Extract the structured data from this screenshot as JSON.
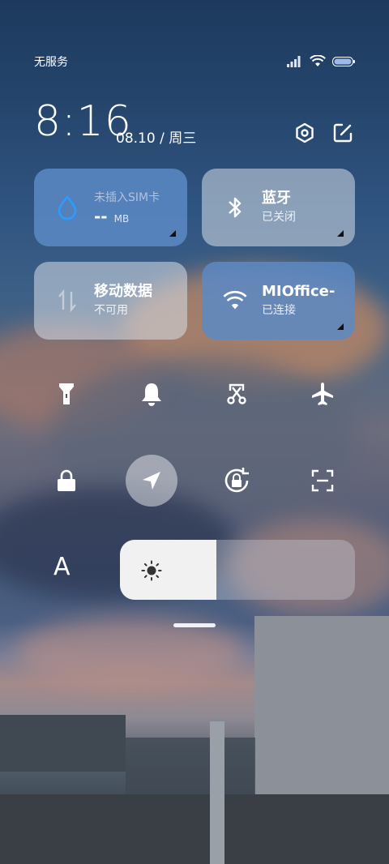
{
  "status_bar": {
    "carrier": "无服务"
  },
  "header": {
    "time": "8:16",
    "date": "08.10 / 周三"
  },
  "tiles": [
    {
      "title": "未插入SIM卡",
      "value": "--",
      "unit": "MB",
      "state": "off",
      "icon": "water-drop-icon"
    },
    {
      "title": "蓝牙",
      "subtitle": "已关闭",
      "state": "off",
      "icon": "bluetooth-icon"
    },
    {
      "title": "移动数据",
      "subtitle": "不可用",
      "state": "off",
      "icon": "mobile-data-icon"
    },
    {
      "title": "MIOffice-",
      "subtitle": "已连接",
      "state": "on",
      "icon": "wifi-icon"
    }
  ],
  "toggles": [
    {
      "name": "flashlight-icon",
      "active": false
    },
    {
      "name": "bell-icon",
      "active": false
    },
    {
      "name": "screenshot-icon",
      "active": false
    },
    {
      "name": "airplane-icon",
      "active": false
    },
    {
      "name": "lock-icon",
      "active": false
    },
    {
      "name": "location-icon",
      "active": true
    },
    {
      "name": "rotation-lock-icon",
      "active": false
    },
    {
      "name": "scan-icon",
      "active": false
    }
  ],
  "font_size_label": "A",
  "brightness": {
    "level": 0.41
  },
  "colors": {
    "tile_on": "#5c89c4",
    "tile_off": "#d7dee8"
  }
}
